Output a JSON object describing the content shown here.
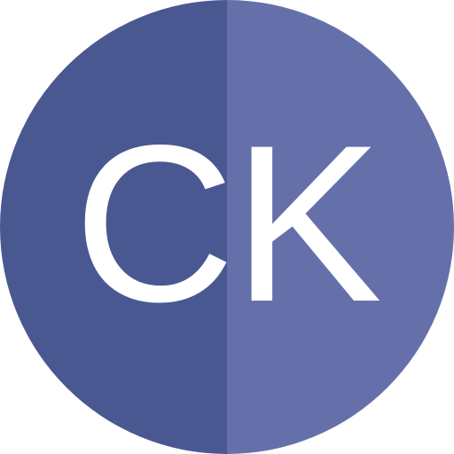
{
  "avatar": {
    "initials": "CK",
    "colors": {
      "left": "#4a5892",
      "right": "#6570ab",
      "text": "#ffffff"
    }
  }
}
